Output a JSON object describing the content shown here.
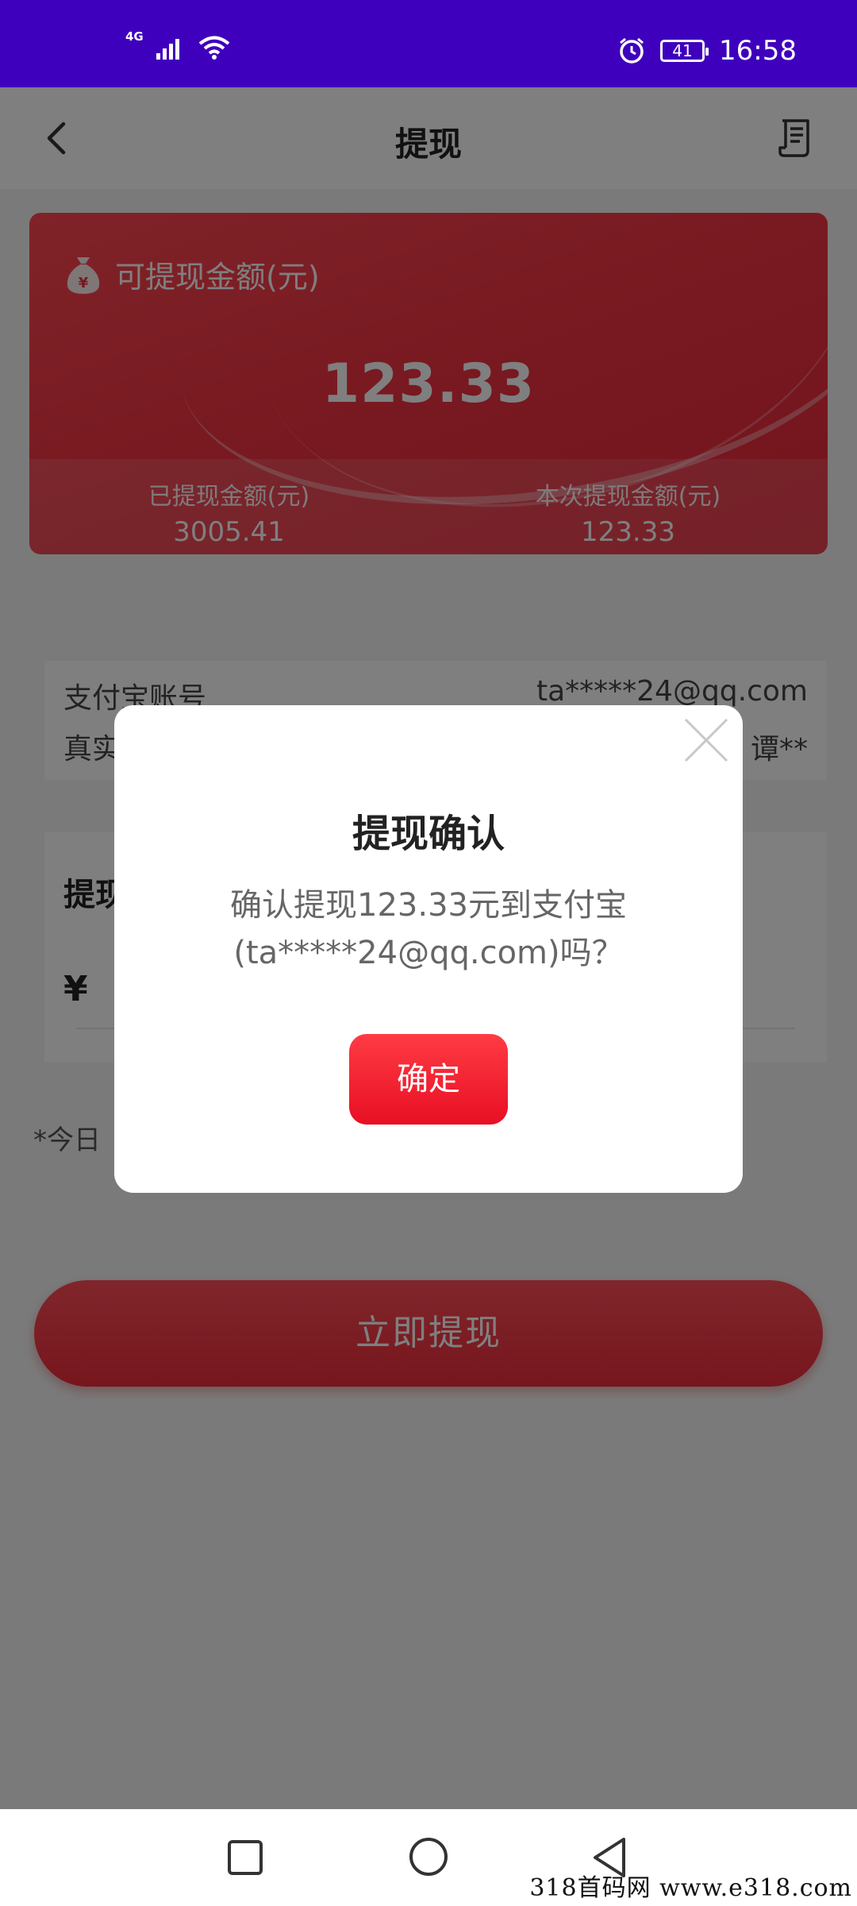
{
  "status_bar": {
    "network": "4G",
    "battery": "41",
    "time": "16:58",
    "icons": [
      "signal-icon",
      "wifi-icon",
      "alarm-icon",
      "battery-icon"
    ]
  },
  "header": {
    "title": "提现",
    "back_icon": "chevron-left-icon",
    "record_icon": "receipt-icon"
  },
  "balance_card": {
    "label": "可提现金额(元)",
    "amount": "123.33",
    "withdrawn_label": "已提现金额(元)",
    "withdrawn_value": "3005.41",
    "current_label": "本次提现金额(元)",
    "current_value": "123.33",
    "colors": {
      "card": "#f03040"
    }
  },
  "account": {
    "alipay_label": "支付宝账号",
    "alipay_value": "ta*****24@qq.com",
    "name_label": "真实",
    "name_value": "谭**"
  },
  "withdraw": {
    "title": "提现",
    "currency": "¥"
  },
  "today_note": "*今日",
  "submit_label": "立即提现",
  "dialog": {
    "title": "提现确认",
    "message_line1": "确认提现123.33元到支付宝",
    "message_line2": "(ta*****24@qq.com)吗？",
    "confirm_label": "确定",
    "close_icon": "close-icon",
    "colors": {
      "confirm": "#f01d2e"
    }
  },
  "nav_bar": {
    "icons": [
      "recent-apps-icon",
      "home-icon",
      "back-icon"
    ]
  },
  "watermark": "318首码网  www.e318.com"
}
